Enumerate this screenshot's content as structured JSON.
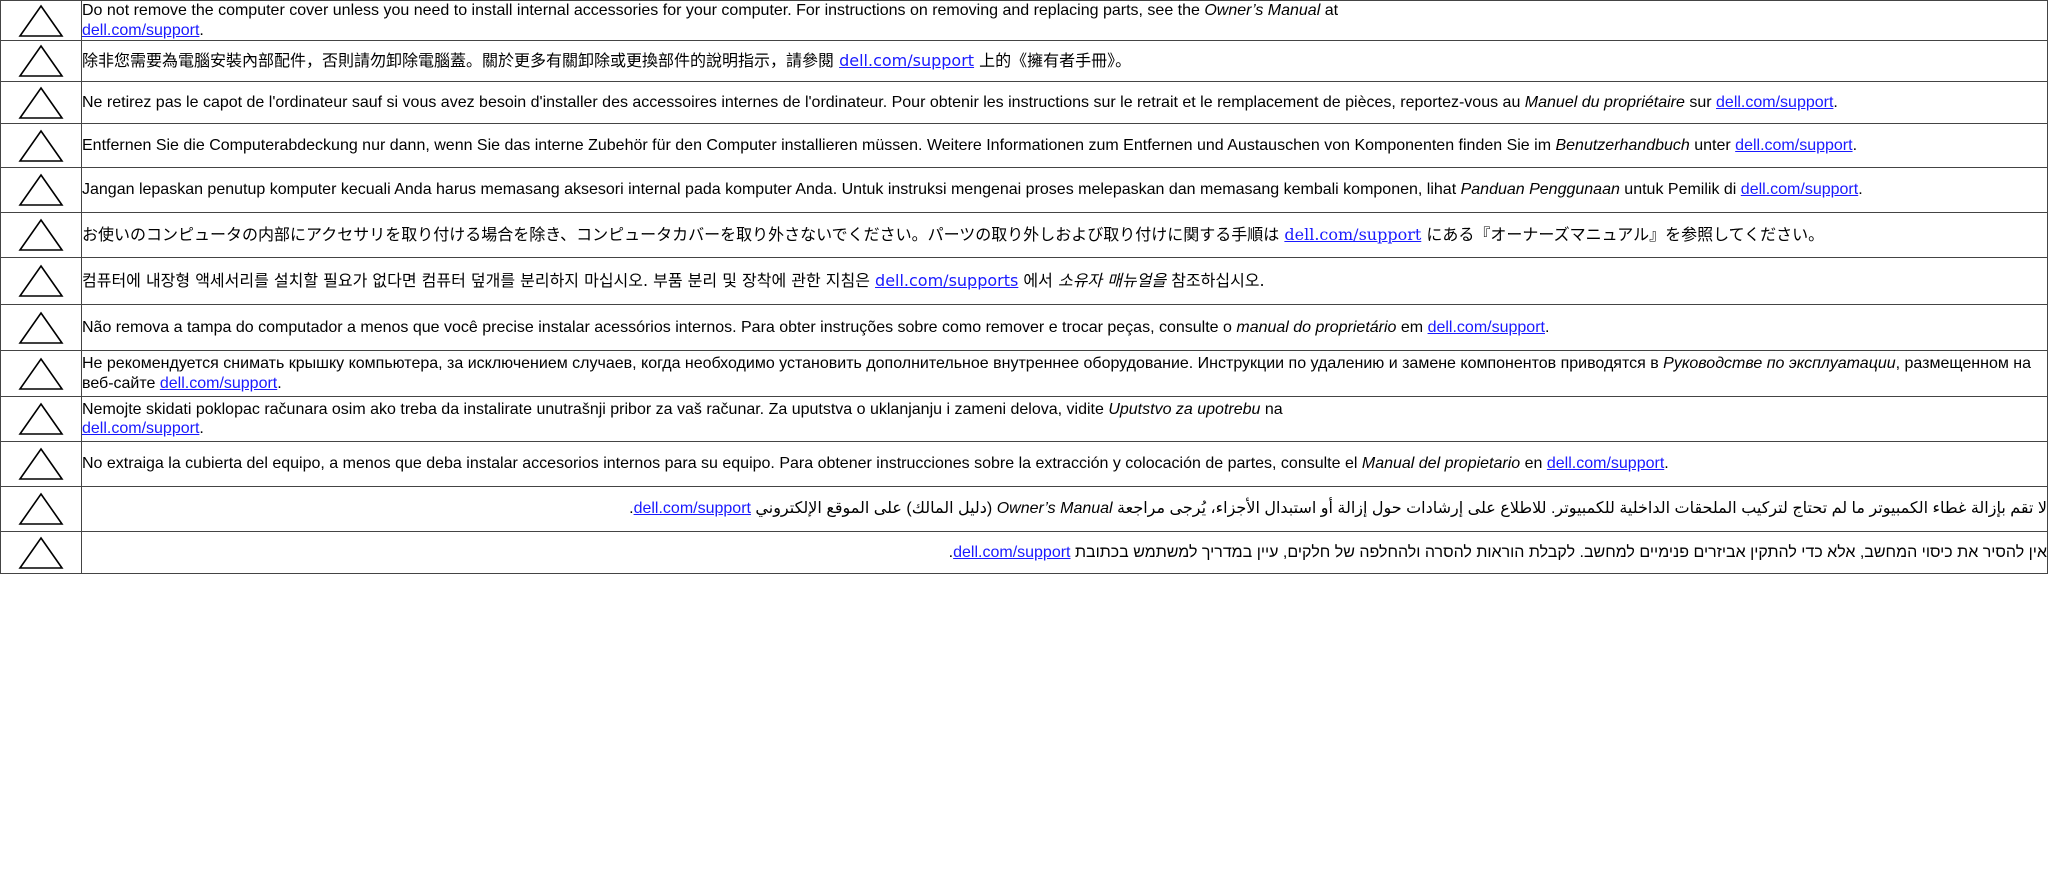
{
  "notices": [
    {
      "lang": "en",
      "before": "Do not remove the computer cover unless you need to install internal accessories for your computer. For instructions on removing and replacing parts, see the ",
      "em": "Owner’s Manual",
      "mid": " at ",
      "link": "dell.com/support",
      "after": "."
    },
    {
      "lang": "zh-TW",
      "before": "除非您需要為電腦安裝內部配件，否則請勿卸除電腦蓋。關於更多有關卸除或更換部件的說明指示，請參閱 ",
      "em": "",
      "mid": "",
      "link": "dell.com/support",
      "after": " 上的《擁有者手冊》。"
    },
    {
      "lang": "fr",
      "before": "Ne retirez pas le capot de l'ordinateur sauf si vous avez besoin d'installer des accessoires internes de l'ordinateur. Pour obtenir les instructions sur le retrait et le remplacement de pièces, reportez-vous au ",
      "em": "Manuel du propriétaire",
      "mid": " sur ",
      "link": "dell.com/support",
      "after": "."
    },
    {
      "lang": "de",
      "before": "Entfernen Sie die Computerabdeckung nur dann, wenn Sie das interne Zubehör für den Computer installieren müssen. Weitere Informationen zum Entfernen und Austauschen von Komponenten finden Sie im ",
      "em": "Benutzerhandbuch",
      "mid": " unter ",
      "link": "dell.com/support",
      "after": "."
    },
    {
      "lang": "id",
      "before": "Jangan lepaskan penutup komputer kecuali Anda harus memasang aksesori internal pada komputer Anda. Untuk instruksi mengenai proses melepaskan dan memasang kembali komponen, lihat ",
      "em": "Panduan Penggunaan",
      "mid": " untuk Pemilik di ",
      "link": "dell.com/support",
      "after": "."
    },
    {
      "lang": "ja",
      "before": "お使いのコンピュータの内部にアクセサリを取り付ける場合を除き、コンピュータカバーを取り外さないでください。パーツの取り外しおよび取り付けに関する手順は ",
      "em": "",
      "mid": "",
      "link": "dell.com/support",
      "after": " にある『オーナーズマニュアル』を参照してください。"
    },
    {
      "lang": "ko",
      "before": "컴퓨터에 내장형 액세서리를 설치할 필요가 없다면 컴퓨터 덮개를 분리하지 마십시오. 부품 분리 및 장착에 관한 지침은 ",
      "em": "",
      "mid": "",
      "link": "dell.com/supports",
      "after": " 에서 ",
      "em2": "소유자 매뉴얼을",
      "after2": " 참조하십시오."
    },
    {
      "lang": "pt",
      "before": "Não remova a tampa do computador a menos que você precise instalar acessórios internos. Para obter instruções sobre como remover e trocar peças, consulte o ",
      "em": "manual do proprietário",
      "mid": " em ",
      "link": "dell.com/support",
      "after": "."
    },
    {
      "lang": "ru",
      "before": "Не рекомендуется снимать крышку компьютера, за исключением случаев, когда необходимо установить дополнительное внутреннее оборудование. Инструкции по удалению и замене компонентов приводятся в ",
      "em": "Руководстве по эксплуатации",
      "mid": ", размещенном на веб-сайте ",
      "link": "dell.com/support",
      "after": "."
    },
    {
      "lang": "sr",
      "before": "Nemojte skidati poklopac računara osim ako treba da instalirate unutrašnji pribor za vaš računar. Za uputstva o uklanjanju i zameni delova, vidite ",
      "em": "Uputstvo za upotrebu",
      "mid": " na ",
      "link": "dell.com/support",
      "after": "."
    },
    {
      "lang": "es",
      "before": "No extraiga la cubierta del equipo, a menos que deba instalar accesorios internos para su equipo. Para obtener instrucciones sobre la extracción y colocación de partes, consulte el ",
      "em": "Manual del propietario",
      "mid": " en ",
      "link": "dell.com/support",
      "after": "."
    },
    {
      "lang": "ar",
      "before": "لا تقم بإزالة غطاء الكمبيوتر ما لم تحتاج لتركيب الملحقات الداخلية للكمبيوتر. للاطلاع على إرشادات حول إزالة أو استبدال الأجزاء، يُرجى مراجعة ",
      "em": "Owner’s Manual",
      "mid": " (دليل المالك) على الموقع الإلكتروني ",
      "link": "dell.com/support",
      "after": "."
    },
    {
      "lang": "he",
      "before": "אין להסיר את כיסוי המחשב, אלא כדי להתקין אביזרים פנימיים למחשב. לקבלת הוראות להסרה ולהחלפה של חלקים, עיין במדריך למשתמש בכתובת ",
      "em": "",
      "mid": "",
      "link": "dell.com/support",
      "after": "."
    }
  ]
}
